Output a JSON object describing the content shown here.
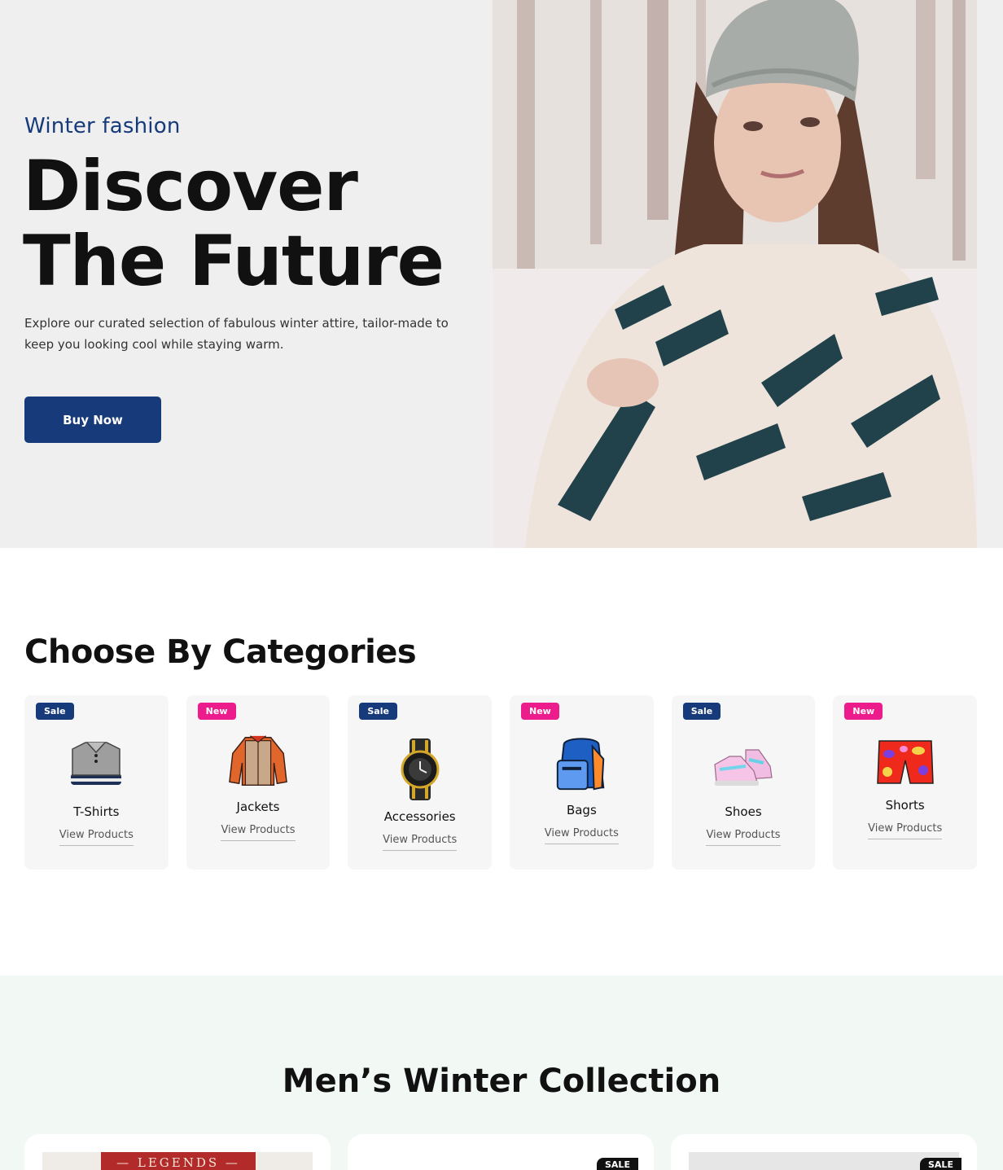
{
  "hero": {
    "eyebrow": "Winter fashion",
    "headline_line1": "Discover",
    "headline_line2": "The Future",
    "description": "Explore our curated selection of fabulous winter attire, tailor-made to keep you looking cool while staying warm.",
    "button_label": "Buy Now",
    "image_alt": "Woman in knit beanie and striped winter sweater"
  },
  "categories": {
    "title": "Choose By Categories",
    "items": [
      {
        "badge": "Sale",
        "badge_type": "sale",
        "name": "T-Shirts",
        "link": "View Products",
        "icon": "tshirt-icon"
      },
      {
        "badge": "New",
        "badge_type": "new",
        "name": "Jackets",
        "link": "View Products",
        "icon": "jacket-icon"
      },
      {
        "badge": "Sale",
        "badge_type": "sale",
        "name": "Accessories",
        "link": "View Products",
        "icon": "watch-icon"
      },
      {
        "badge": "New",
        "badge_type": "new",
        "name": "Bags",
        "link": "View Products",
        "icon": "backpack-icon"
      },
      {
        "badge": "Sale",
        "badge_type": "sale",
        "name": "Shoes",
        "link": "View Products",
        "icon": "shoe-icon"
      },
      {
        "badge": "New",
        "badge_type": "new",
        "name": "Shorts",
        "link": "View Products",
        "icon": "shorts-icon"
      }
    ]
  },
  "collection": {
    "title": "Men’s Winter Collection",
    "products": [
      {
        "thumb_text": "— LEGENDS —",
        "sale_tag": ""
      },
      {
        "thumb_text": "",
        "sale_tag": "SALE"
      },
      {
        "thumb_text": "",
        "sale_tag": "SALE"
      }
    ]
  },
  "colors": {
    "primary": "#163a7a",
    "new_badge": "#ec1c8c",
    "hero_bg": "#efefef",
    "card_bg": "#f6f6f6",
    "collection_bg": "#f2f9f5"
  }
}
